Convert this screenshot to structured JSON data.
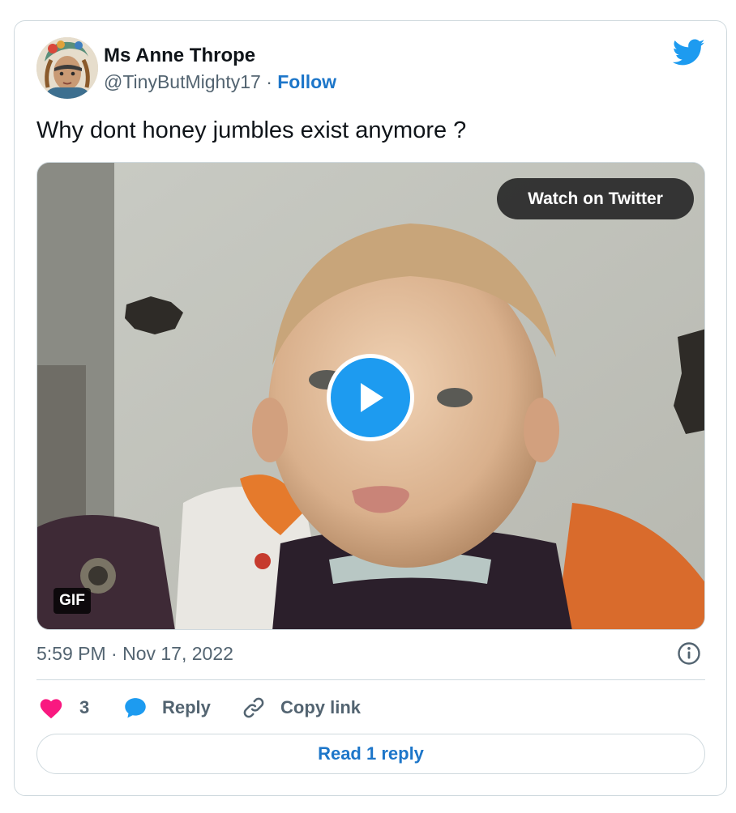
{
  "tweet": {
    "author_name": "Ms Anne Thrope",
    "handle": "@TinyButMighty17",
    "separator": "·",
    "follow_label": "Follow",
    "text": "Why dont honey jumbles exist anymore ?",
    "media": {
      "watch_label": "Watch on Twitter",
      "gif_label": "GIF"
    },
    "timestamp": "5:59 PM · Nov 17, 2022",
    "actions": {
      "like_count": "3",
      "reply_label": "Reply",
      "copy_link_label": "Copy link"
    },
    "read_reply_label": "Read 1 reply"
  },
  "colors": {
    "brand_blue": "#1d9bf0",
    "link_blue": "#1d76c9",
    "like_pink": "#f91880",
    "muted_text": "#536471",
    "border": "#cfd9de"
  },
  "icons": [
    "twitter-bird-icon",
    "play-icon",
    "info-icon",
    "heart-icon",
    "reply-bubble-icon",
    "link-icon"
  ]
}
